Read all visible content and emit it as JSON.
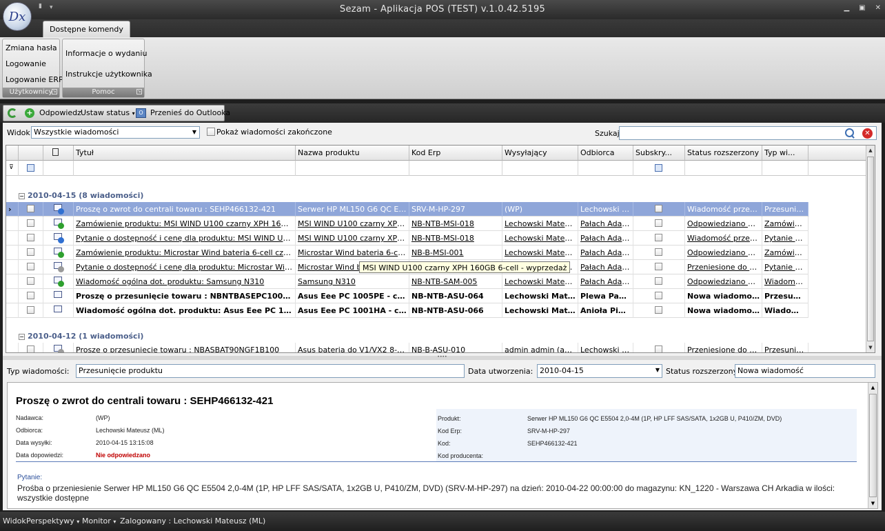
{
  "window": {
    "title": "Sezam - Aplikacja POS (TEST) v.1.0.42.5195",
    "logo_text": "Dx"
  },
  "ribbon": {
    "tab": "Dostępne komendy",
    "groups": [
      {
        "label": "Użytkownicy",
        "items": [
          "Zmiana hasła",
          "Logowanie",
          "Logowanie ERP"
        ]
      },
      {
        "label": "Pomoc",
        "items": [
          "Informacje o wydaniu",
          "Instrukcje użytkownika"
        ]
      }
    ]
  },
  "toolbar": {
    "reply": "Odpowiedz",
    "set_status": "Ustaw status",
    "to_outlook": "Przenieś do Outlooka"
  },
  "filter": {
    "view_label": "Widok",
    "view_value": "Wszystkie wiadomości",
    "show_finished": "Pokaż wiadomości zakończone",
    "search_label": "Szukaj",
    "search_value": ""
  },
  "grid": {
    "columns": [
      "Tytuł",
      "Nazwa produktu",
      "Kod Erp",
      "Wysyłający",
      "Odbiorca",
      "Subskry...",
      "Status rozszerzony",
      "Typ wi..."
    ],
    "groups": [
      {
        "label": "2010-04-15 (8 wiadomości)",
        "rows": [
          {
            "icon": "q",
            "title": "Proszę o zwrot do centrali towaru : SEHP466132-421",
            "product": "Serwer HP ML150 G6 QC E550...",
            "erp": "SRV-M-HP-297",
            "sender": "(WP)",
            "recipient": "Lechowski M...",
            "status": "Wiadomość przeczy...",
            "type": "Przesunię..."
          },
          {
            "icon": "ok",
            "title": "Zamówienie produktu: MSI WIND U100 czarny XPH 160GB 6-cell...",
            "product": "MSI WIND U100 czarny XPH 1...",
            "erp": "NB-NTB-MSI-018",
            "sender": "Lechowski Mateusz...",
            "recipient": "Pałach Adam...",
            "status": "Odpowiedziano na ...",
            "type": "Zamówienie"
          },
          {
            "icon": "q",
            "title": "Pytanie o dostępność i cenę dla produktu: MSI WIND U100 czar...",
            "product": "MSI WIND U100 czarny XPH 1...",
            "erp": "NB-NTB-MSI-018",
            "sender": "Lechowski Mateusz...",
            "recipient": "Pałach Adam...",
            "status": "Wiadomość przeczy...",
            "type": "Pytanie o ..."
          },
          {
            "icon": "ok",
            "title": "Zamówienie produktu: Microstar Wind bateria 6-cell czarna",
            "product": "Microstar Wind bateria 6-cell ...",
            "erp": "NB-B-MSI-001",
            "sender": "Lechowski Mateusz...",
            "recipient": "Pałach Adam...",
            "status": "Odpowiedziano na ...",
            "type": "Zamówienie"
          },
          {
            "icon": "fw",
            "title": "Pytanie o dostępność i cenę dla produktu: Microstar Wind bateri...",
            "product": "Microstar Wind bateria 6-cell bi...",
            "erp": "NB-B-MSI-002",
            "sender": "Lechowski Mateusz...",
            "recipient": "Pałach Adam...",
            "status": "Przeniesione do out...",
            "type": "Pytanie o ..."
          },
          {
            "icon": "ok",
            "title": "Wiadomość ogólna dot. produktu: Samsung N310",
            "product": "Samsung N310",
            "erp": "NB-NTB-SAM-005",
            "sender": "Lechowski Mateusz...",
            "recipient": "Pałach Adam...",
            "status": "Odpowiedziano na ...",
            "type": "Wiadomoś..."
          },
          {
            "icon": "new",
            "title": "Proszę o przesunięcie towaru : NBNTBASEPC1005PE",
            "product": "Asus Eee PC 1005PE - czar...",
            "erp": "NB-NTB-ASU-064",
            "sender": "Lechowski Mate...",
            "recipient": "Plewa Paw...",
            "status": "Nowa wiadomość",
            "type": "Przesuni..."
          },
          {
            "icon": "new",
            "title": "Wiadomość ogólna dot. produktu: Asus Eee PC 1001HA ...",
            "product": "Asus Eee PC 1001HA - czar...",
            "erp": "NB-NTB-ASU-066",
            "sender": "Lechowski Mate...",
            "recipient": "Anioła Piot...",
            "status": "Nowa wiadomość",
            "type": "Wiadomo..."
          }
        ]
      },
      {
        "label": "2010-04-12 (1 wiadomości)",
        "rows": [
          {
            "icon": "fw",
            "title": "Proszę o przesunięcie towaru : NBASBAT90NGF1B100",
            "product": "Asus bateria do V1/VX2 8-cell",
            "erp": "NB-B-ASU-010",
            "sender": "admin admin (admin)",
            "recipient": "Lechowski M...",
            "status": "Przeniesione do out...",
            "type": "Przesunię..."
          }
        ]
      }
    ],
    "tooltip": "MSI WIND U100 czarny XPH 160GB 6-cell - wyprzedaż"
  },
  "detail": {
    "type_label": "Typ wiadomości:",
    "type_value": "Przesunięcie produktu",
    "created_label": "Data utworzenia:",
    "created_value": "2010-04-15",
    "status_label": "Status rozszerzony:",
    "status_value": "Nowa wiadomość",
    "heading": "Proszę o zwrot do centrali towaru : SEHP466132-421",
    "sender_k": "Nadawca:",
    "sender_v": "(WP)",
    "recipient_k": "Odbiorca:",
    "recipient_v": "Lechowski Mateusz (ML)",
    "sent_k": "Data wysyłki:",
    "sent_v": "2010-04-15 13:15:08",
    "answer_k": "Data dopowiedzi:",
    "answer_v": "Nie odpowiedzano",
    "product_k": "Produkt:",
    "product_v": "Serwer HP ML150 G6 QC E5504 2,0-4M (1P, HP LFF SAS/SATA, 1x2GB U, P410/ZM, DVD)",
    "erp_k": "Kod Erp:",
    "erp_v": "SRV-M-HP-297",
    "code_k": "Kod:",
    "code_v": "SEHP466132-421",
    "maker_k": "Kod producenta:",
    "maker_v": "",
    "question_label": "Pytanie:",
    "question_body": "Prośba o przeniesienie Serwer HP ML150 G6 QC E5504 2,0-4M (1P, HP LFF SAS/SATA, 1x2GB U, P410/ZM, DVD) (SRV-M-HP-297) na dzień: 2010-04-22 00:00:00 do magazynu: KN_1220 - Warszawa CH Arkadia w ilości: wszystkie dostępne"
  },
  "statusbar": {
    "view": "Widok",
    "perspectives": "Perspektywy",
    "monitor": "Monitor",
    "logged": "Zalogowany : Lechowski Mateusz (ML)"
  },
  "colors": {
    "selected_row": "#8fa6d9",
    "group_header": "#4b5f8a",
    "unanswered": "#c00000"
  }
}
